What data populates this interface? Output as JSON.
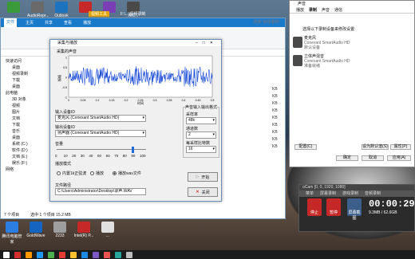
{
  "desktop_icons": [
    {
      "label": "",
      "color": "#3a9b3a"
    },
    {
      "label": "AudioRepr...",
      "color": "#6a6a6a"
    },
    {
      "label": "Outlook",
      "color": "#1e73be"
    },
    {
      "label": "",
      "color": "#c62828"
    },
    {
      "label": "",
      "color": "#7b3fb5"
    },
    {
      "label": "AIC...",
      "color": "#4a4a4a"
    }
  ],
  "bottom_icons": [
    {
      "label": "腾讯电脑管家",
      "color": "#2b7de1"
    },
    {
      "label": "GoldWave",
      "color": "#1565c0"
    },
    {
      "label": "2233",
      "color": "#9e9e9e"
    },
    {
      "label": "Intel(R) P...",
      "color": "#c62828"
    },
    {
      "label": "...",
      "color": "#e0e0e0"
    }
  ],
  "explorer": {
    "context_tab": "视频工具",
    "path_tail": "F:\\...\\视频录制",
    "tabs": [
      "文件",
      "主页",
      "共享",
      "查看",
      "播放"
    ],
    "search_placeholder": "搜索\"视频录制\"",
    "nav": [
      "快速访问",
      "桌面",
      "视频录制",
      "下载",
      "桌面",
      "此电脑",
      "3D 对象",
      "视频",
      "图片",
      "文档",
      "下载",
      "音乐",
      "桌面",
      "系统 (C:)",
      "软件 (D:)",
      "文档 (E:)",
      "娱乐 (F:)",
      "网络"
    ],
    "kb_values": [
      "KB",
      "KB",
      "KB",
      "KB",
      "KB",
      "KB",
      "KB",
      "KB",
      "KB"
    ],
    "status": {
      "count": "7 个项目",
      "selected": "选中 1 个项目 15.2 MB"
    }
  },
  "dialog": {
    "title": "采集与播放",
    "waveform_label": "采集的声音",
    "y_axis_label": "振幅",
    "x_axis_label": "时间",
    "y_ticks": [
      "1",
      "0.5",
      "0",
      "-0.5",
      "-1"
    ],
    "x_ticks": [
      "0",
      "0.05",
      "0.1",
      "0.15",
      "0.2",
      "0.25",
      "0.3",
      "0.35",
      "0.4",
      "0.45",
      "0.5"
    ],
    "input_device_label": "输入设备ID",
    "input_device_value": "麦克风 (Conexant SmartAudio HD)",
    "output_device_label": "输出设备ID",
    "output_device_value": "扬声器 (Conexant SmartAudio HD)",
    "volume_label": "音量",
    "volume_ticks": [
      "0",
      "10",
      "20",
      "30",
      "40",
      "50",
      "60",
      "70",
      "80",
      "90",
      "100"
    ],
    "volume_level": 85,
    "playback_mode_label": "播放模式",
    "modes": [
      "内置1k正弦波",
      "播放",
      "播放wav文件"
    ],
    "selected_mode": "播放wav文件",
    "file_path_label": "文件路径",
    "file_path_value": "C:\\Users\\Administrator\\Desktop\\录声.WAV",
    "format_label": "声音输入输出格式",
    "sample_rate_label": "采样率",
    "sample_rate_value": "48k",
    "channels_label": "通道数",
    "channels_value": "2",
    "bits_label": "每采样比特数",
    "bits_value": "16",
    "start_label": "开始",
    "close_label": "关闭"
  },
  "sound": {
    "title": "声音",
    "tabs": [
      "播放",
      "录制",
      "声音",
      "通信"
    ],
    "instruction": "选择以下录制设备来修改设置:",
    "devices": [
      {
        "name": "麦克风",
        "desc": "Conexant SmartAudio HD",
        "state": "默认设备"
      },
      {
        "name": "立体声混音",
        "desc": "Conexant SmartAudio HD",
        "state": "准备就绪"
      }
    ],
    "configure_label": "配置(C)",
    "default_label": "设为默认值(S)",
    "properties_label": "属性(P)",
    "ok_label": "确定",
    "cancel_label": "取消",
    "apply_label": "应用(A)"
  },
  "ocam": {
    "title": "oCam [0, 0, 1920, 1080]",
    "tabs": [
      "菜单",
      "屏幕录制",
      "游戏录制",
      "音频录制"
    ],
    "tools": [
      "停止",
      "暂停",
      "",
      "屏幕截图"
    ],
    "time": "00:00:29",
    "size": "9.3MB / 62.6GB"
  },
  "taskbar_colors": [
    "#ffffff",
    "#d32f2f",
    "#ff9800",
    "#2196f3",
    "#4caf50",
    "#e53935",
    "#fbc02d",
    "#1e88e5",
    "#7e57c2",
    "#ef5350",
    "#26a69a",
    "#bdbdbd"
  ]
}
